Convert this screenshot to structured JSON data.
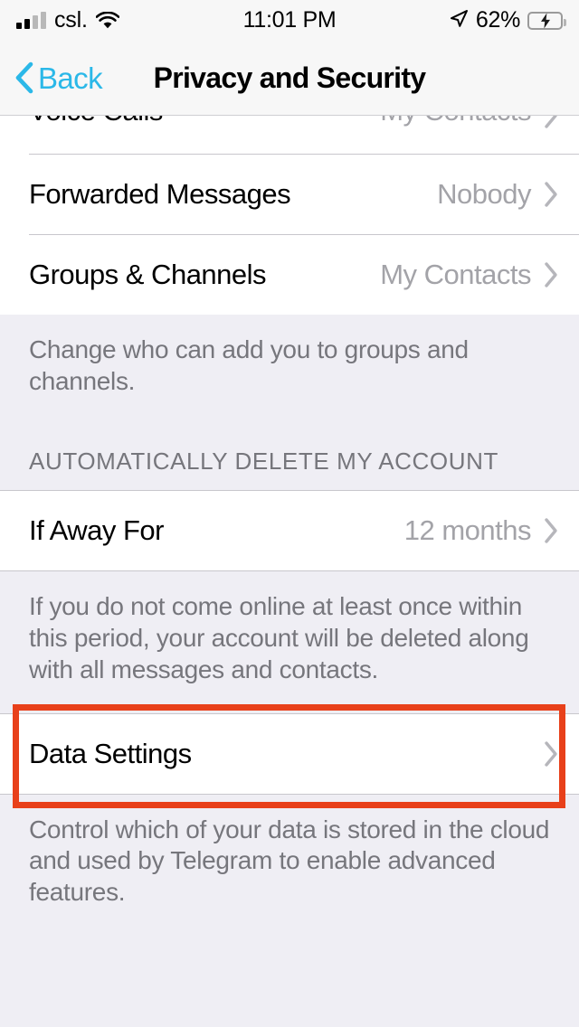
{
  "status_bar": {
    "carrier": "csl.",
    "time": "11:01 PM",
    "battery_percent": "62%",
    "battery_level": 62,
    "signal_bars_filled": 2,
    "signal_bars_total": 4,
    "wifi_icon": "wifi-icon",
    "location_icon": "location-arrow-icon",
    "battery_icon": "battery-charging-icon"
  },
  "nav": {
    "back_label": "Back",
    "back_icon": "chevron-left-icon",
    "title": "Privacy and Security",
    "accent_color": "#2BB8E8"
  },
  "privacy_section": {
    "rows": [
      {
        "label": "Voice Calls",
        "value": "My Contacts",
        "clipped": true
      },
      {
        "label": "Forwarded Messages",
        "value": "Nobody",
        "clipped": false
      },
      {
        "label": "Groups & Channels",
        "value": "My Contacts",
        "clipped": false
      }
    ],
    "footer": "Change who can add you to groups and channels."
  },
  "auto_delete_section": {
    "header": "AUTOMATICALLY DELETE MY ACCOUNT",
    "rows": [
      {
        "label": "If Away For",
        "value": "12 months"
      }
    ],
    "footer": "If you do not come online at least once within this period, your account will be deleted along with all messages and contacts."
  },
  "data_section": {
    "rows": [
      {
        "label": "Data Settings",
        "value": ""
      }
    ],
    "footer": "Control which of your data is stored in the cloud and used by Telegram to enable advanced features.",
    "highlighted": true,
    "highlight_color": "#E8401A"
  },
  "colors": {
    "page_background": "#EFEEF4",
    "cell_background": "#FFFFFF",
    "nav_background": "#F7F7F7",
    "separator": "#C8C7CC",
    "secondary_text": "#A3A3A8",
    "footer_text": "#76767C",
    "battery_green": "#3BD157"
  }
}
